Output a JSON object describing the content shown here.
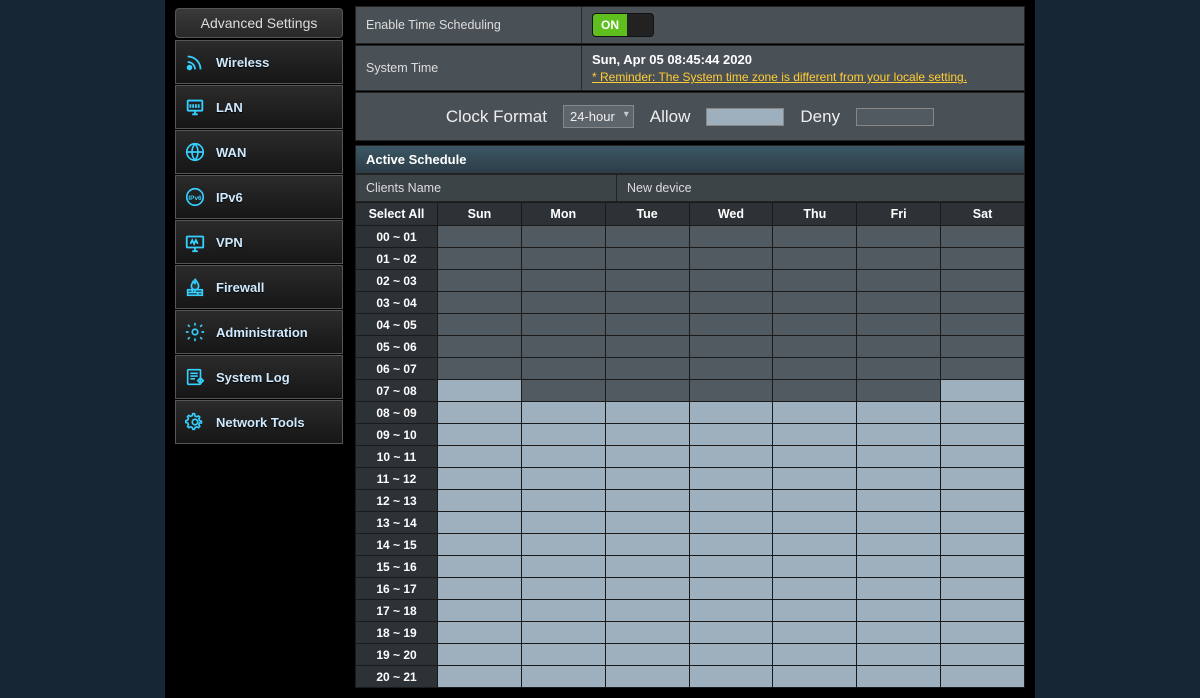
{
  "sidebar": {
    "header": "Advanced Settings",
    "items": [
      {
        "label": "Wireless",
        "icon": "wireless"
      },
      {
        "label": "LAN",
        "icon": "lan"
      },
      {
        "label": "WAN",
        "icon": "wan"
      },
      {
        "label": "IPv6",
        "icon": "ipv6"
      },
      {
        "label": "VPN",
        "icon": "vpn"
      },
      {
        "label": "Firewall",
        "icon": "firewall"
      },
      {
        "label": "Administration",
        "icon": "admin"
      },
      {
        "label": "System Log",
        "icon": "syslog"
      },
      {
        "label": "Network Tools",
        "icon": "nettools"
      }
    ]
  },
  "settings": {
    "enable_label": "Enable Time Scheduling",
    "enable_state": "ON",
    "systime_label": "System Time",
    "systime_value": "Sun, Apr 05 08:45:44 2020",
    "systime_reminder": "* Reminder: The System time zone is different from your locale setting."
  },
  "controls": {
    "clock_format_label": "Clock Format",
    "clock_format_value": "24-hour",
    "allow_label": "Allow",
    "deny_label": "Deny"
  },
  "schedule": {
    "section_title": "Active Schedule",
    "clients_label": "Clients Name",
    "clients_value": "New device",
    "select_all": "Select All",
    "days": [
      "Sun",
      "Mon",
      "Tue",
      "Wed",
      "Thu",
      "Fri",
      "Sat"
    ],
    "time_slots": [
      "00 ~ 01",
      "01 ~ 02",
      "02 ~ 03",
      "03 ~ 04",
      "04 ~ 05",
      "05 ~ 06",
      "06 ~ 07",
      "07 ~ 08",
      "08 ~ 09",
      "09 ~ 10",
      "10 ~ 11",
      "11 ~ 12",
      "12 ~ 13",
      "13 ~ 14",
      "14 ~ 15",
      "15 ~ 16",
      "16 ~ 17",
      "17 ~ 18",
      "18 ~ 19",
      "19 ~ 20",
      "20 ~ 21"
    ],
    "grid": [
      [
        0,
        0,
        0,
        0,
        0,
        0,
        0
      ],
      [
        0,
        0,
        0,
        0,
        0,
        0,
        0
      ],
      [
        0,
        0,
        0,
        0,
        0,
        0,
        0
      ],
      [
        0,
        0,
        0,
        0,
        0,
        0,
        0
      ],
      [
        0,
        0,
        0,
        0,
        0,
        0,
        0
      ],
      [
        0,
        0,
        0,
        0,
        0,
        0,
        0
      ],
      [
        0,
        0,
        0,
        0,
        0,
        0,
        0
      ],
      [
        1,
        0,
        0,
        0,
        0,
        0,
        1
      ],
      [
        1,
        1,
        1,
        1,
        1,
        1,
        1
      ],
      [
        1,
        1,
        1,
        1,
        1,
        1,
        1
      ],
      [
        1,
        1,
        1,
        1,
        1,
        1,
        1
      ],
      [
        1,
        1,
        1,
        1,
        1,
        1,
        1
      ],
      [
        1,
        1,
        1,
        1,
        1,
        1,
        1
      ],
      [
        1,
        1,
        1,
        1,
        1,
        1,
        1
      ],
      [
        1,
        1,
        1,
        1,
        1,
        1,
        1
      ],
      [
        1,
        1,
        1,
        1,
        1,
        1,
        1
      ],
      [
        1,
        1,
        1,
        1,
        1,
        1,
        1
      ],
      [
        1,
        1,
        1,
        1,
        1,
        1,
        1
      ],
      [
        1,
        1,
        1,
        1,
        1,
        1,
        1
      ],
      [
        1,
        1,
        1,
        1,
        1,
        1,
        1
      ],
      [
        1,
        1,
        1,
        1,
        1,
        1,
        1
      ]
    ]
  }
}
